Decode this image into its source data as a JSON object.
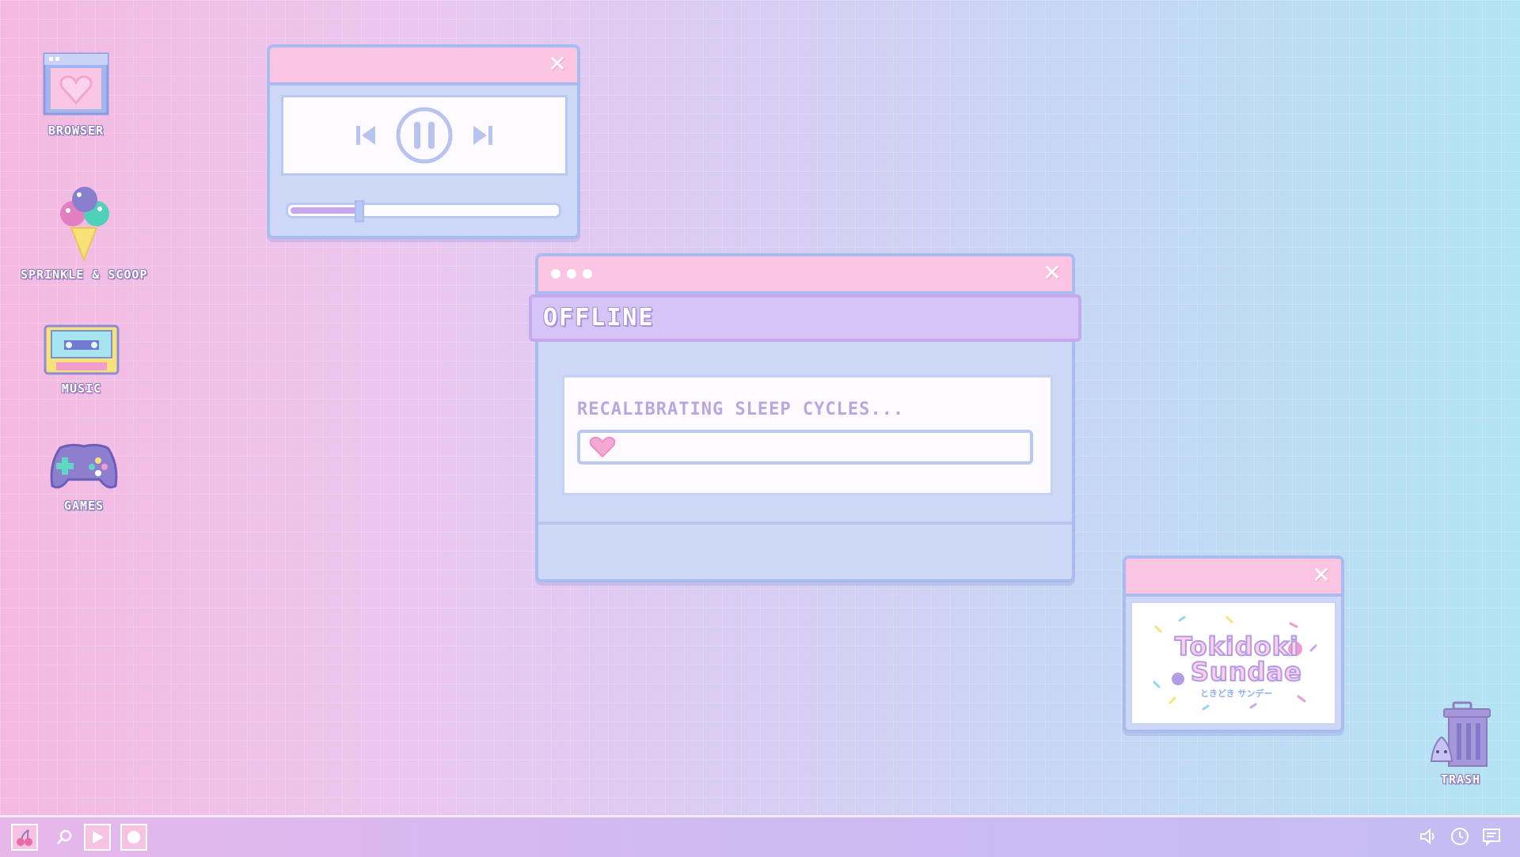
{
  "desktop": {
    "icons": [
      {
        "label": "BROWSER",
        "icon": "browser-heart-icon"
      },
      {
        "label": "SPRINKLE & SCOOP",
        "icon": "ice-cream-icon"
      },
      {
        "label": "MUSIC",
        "icon": "cassette-icon"
      },
      {
        "label": "GAMES",
        "icon": "gamepad-icon"
      }
    ],
    "trash": {
      "label": "TRASH",
      "icon": "trash-can-icon"
    }
  },
  "player": {
    "close_symbol": "✕",
    "controls": [
      "skip-back-icon",
      "pause-icon",
      "skip-forward-icon"
    ],
    "progress_fraction": 0.25
  },
  "offline_dialog": {
    "close_symbol": "✕",
    "title": "OFFLINE",
    "message": "RECALIBRATING SLEEP CYCLES...",
    "progress_fraction": 0.06
  },
  "sticker_window": {
    "close_symbol": "✕",
    "logo_line1": "Tokidoki",
    "logo_line2": "Sundae",
    "logo_sub": "ときどき サンデー"
  },
  "taskbar": {
    "left_items": [
      "cherry-icon",
      "search-icon",
      "play-icon",
      "record-icon"
    ],
    "right_items": [
      "volume-icon",
      "clock-icon",
      "chat-icon"
    ]
  },
  "colors": {
    "window_border": "#a9bbef",
    "titlebar_pink": "#fbc4e2",
    "header_purple": "#d7c4f6",
    "heart_pink": "#f4a9d3",
    "accent_lavender": "#c6a6ec"
  }
}
